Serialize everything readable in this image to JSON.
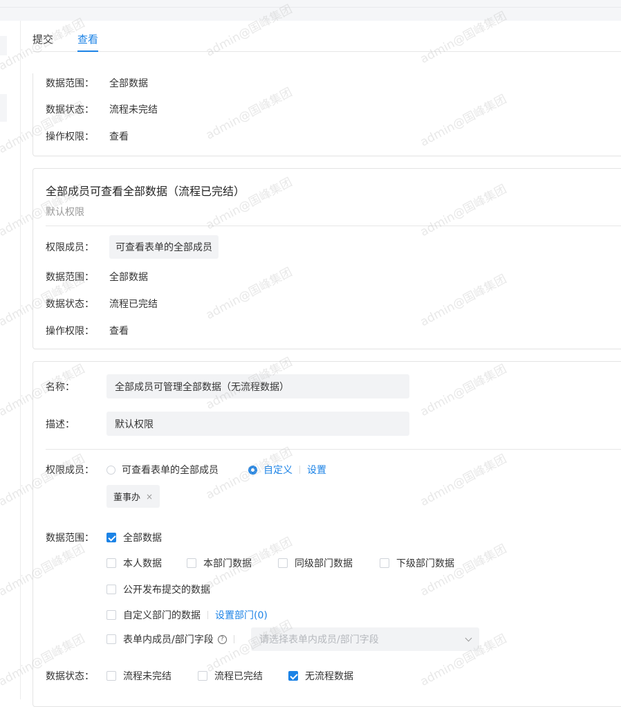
{
  "tabs": [
    {
      "label": "提交"
    },
    {
      "label": "查看"
    }
  ],
  "card1": {
    "rows": [
      {
        "label": "数据范围：",
        "value": "全部数据"
      },
      {
        "label": "数据状态：",
        "value": "流程未完结"
      },
      {
        "label": "操作权限：",
        "value": "查看"
      }
    ]
  },
  "card2": {
    "title": "全部成员可查看全部数据（流程已完结）",
    "subtitle": "默认权限",
    "members_label": "权限成员：",
    "members_value": "可查看表单的全部成员",
    "rows": [
      {
        "label": "数据范围：",
        "value": "全部数据"
      },
      {
        "label": "数据状态：",
        "value": "流程已完结"
      },
      {
        "label": "操作权限：",
        "value": "查看"
      }
    ]
  },
  "card3": {
    "name_label": "名称：",
    "name_value": "全部成员可管理全部数据（无流程数据）",
    "desc_label": "描述：",
    "desc_value": "默认权限",
    "members_label": "权限成员：",
    "member_opt_all": "可查看表单的全部成员",
    "member_opt_custom": "自定义",
    "member_set_link": "设置",
    "member_tag": "董事办",
    "member_tag_close": "×",
    "scope_label": "数据范围：",
    "scope_all": "全部数据",
    "scope_self": "本人数据",
    "scope_dept": "本部门数据",
    "scope_peer": "同级部门数据",
    "scope_sub": "下级部门数据",
    "scope_public": "公开发布提交的数据",
    "scope_custom_dept": "自定义部门的数据",
    "scope_custom_dept_link": "设置部门(0)",
    "scope_field": "表单内成员/部门字段",
    "scope_field_help": "?",
    "scope_field_placeholder": "请选择表单内成员/部门字段",
    "status_label": "数据状态：",
    "status_unfinished": "流程未完结",
    "status_finished": "流程已完结",
    "status_noflow": "无流程数据"
  },
  "watermark": "admin@国峰集团"
}
